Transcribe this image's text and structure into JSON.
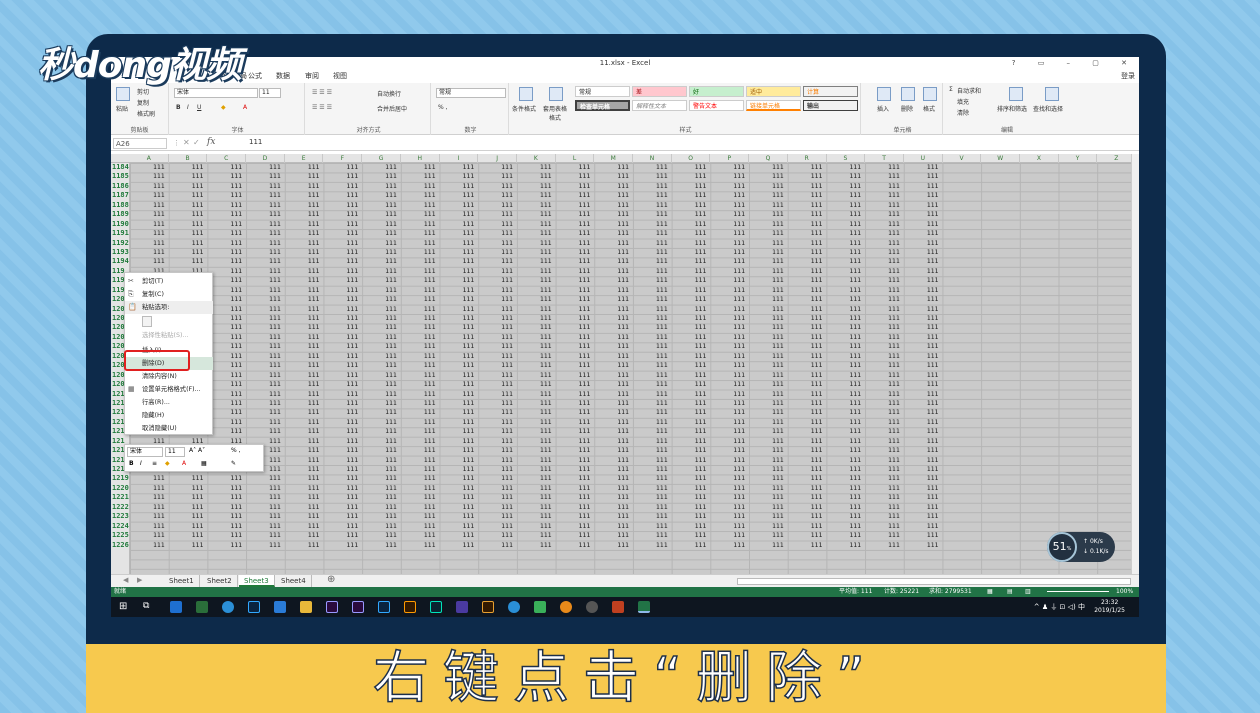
{
  "brand": {
    "logo_text": "秒dong视频"
  },
  "caption": "右键点击“删除”",
  "window": {
    "title": "11.xlsx - Excel",
    "controls": "? ▭ – ▢ ✕",
    "signin": "登录"
  },
  "ribbon_tabs": [
    "页面布局",
    "公式",
    "数据",
    "审阅",
    "视图"
  ],
  "ribbon": {
    "clipboard": {
      "paste": "粘贴",
      "cut": "剪切",
      "copy": "复制",
      "format_painter": "格式刷",
      "label": "剪贴板"
    },
    "font": {
      "name": "宋体",
      "size": "11",
      "label": "字体"
    },
    "alignment": {
      "wrap": "自动换行",
      "merge": "合并后居中",
      "label": "对齐方式"
    },
    "number": {
      "format": "常规",
      "label": "数字"
    },
    "styles": {
      "conditional": "条件格式",
      "table": "套用表格格式",
      "cells": [
        "常规",
        "差",
        "好",
        "适中",
        "计算",
        "检查单元格",
        "解释性文本",
        "警告文本",
        "链接单元格",
        "输出"
      ],
      "label": "样式"
    },
    "cells_group": {
      "insert": "插入",
      "delete": "删除",
      "format": "格式",
      "label": "单元格"
    },
    "editing": {
      "autosum": "自动求和",
      "fill": "填充",
      "clear": "清除",
      "sort": "排序和筛选",
      "find": "查找和选择",
      "label": "编辑"
    }
  },
  "formula_bar": {
    "name_box": "A26",
    "fx": "fx",
    "value": "111"
  },
  "columns": [
    "A",
    "B",
    "C",
    "D",
    "E",
    "F",
    "G",
    "H",
    "I",
    "J",
    "K",
    "L",
    "M",
    "N",
    "O",
    "P",
    "Q",
    "R",
    "S",
    "T",
    "U",
    "V",
    "W",
    "X",
    "Y",
    "Z"
  ],
  "rows": [
    "1184",
    "1185",
    "1186",
    "1187",
    "1188",
    "1189",
    "1190",
    "1191",
    "1192",
    "1193",
    "1194",
    "119",
    "119",
    "119",
    "120",
    "120",
    "120",
    "120",
    "120",
    "120",
    "120",
    "120",
    "120",
    "120",
    "121",
    "121",
    "121",
    "1213",
    "121",
    "121",
    "121",
    "1217",
    "1218",
    "1219",
    "1220",
    "1221",
    "1222",
    "1223",
    "1224",
    "1225",
    "1226"
  ],
  "cell_value": "111",
  "filled_columns": 21,
  "context_menu": [
    {
      "label": "剪切(T)",
      "icon": "✂",
      "state": "normal"
    },
    {
      "label": "复制(C)",
      "icon": "⎘",
      "state": "normal"
    },
    {
      "label": "粘贴选项:",
      "icon": "📋",
      "state": "header"
    },
    {
      "label": "选择性粘贴(S)...",
      "icon": "",
      "state": "disabled"
    },
    {
      "label": "插入(I)",
      "icon": "",
      "state": "normal"
    },
    {
      "label": "删除(D)",
      "icon": "",
      "state": "highlight"
    },
    {
      "label": "清除内容(N)",
      "icon": "",
      "state": "normal"
    },
    {
      "label": "设置单元格格式(F)...",
      "icon": "▦",
      "state": "normal"
    },
    {
      "label": "行高(R)...",
      "icon": "",
      "state": "normal"
    },
    {
      "label": "隐藏(H)",
      "icon": "",
      "state": "normal"
    },
    {
      "label": "取消隐藏(U)",
      "icon": "",
      "state": "normal"
    }
  ],
  "mini_toolbar": {
    "font": "宋体",
    "size": "11"
  },
  "sheets": [
    "Sheet1",
    "Sheet2",
    "Sheet3",
    "Sheet4"
  ],
  "active_sheet": "Sheet3",
  "status": {
    "ready": "就绪",
    "average": "平均值: 111",
    "count": "计数: 25221",
    "sum": "求和: 2799531",
    "zoom": "100%"
  },
  "taskbar": {
    "time": "23:32",
    "date": "2019/1/25",
    "lang": "中"
  },
  "speed_widget": {
    "value": "51",
    "unit": "%",
    "up": "0K/s",
    "down": "0.1K/s"
  },
  "colors": {
    "excel_green": "#217346",
    "caption_bg": "#f7c94e",
    "highlight_red": "#e02020"
  }
}
